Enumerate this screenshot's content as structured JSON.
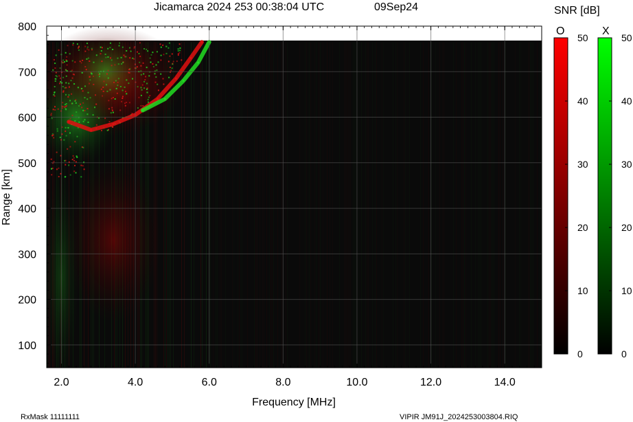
{
  "header": {
    "title": "Jicamarca 2024 253 00:38:04 UTC",
    "date": "09Sep24"
  },
  "footer": {
    "rxmask": "RxMask 11111111",
    "file": "VIPIR  JM91J_2024253003804.RIQ"
  },
  "chart_data": {
    "type": "heatmap",
    "title": "Jicamarca 2024 253 00:38:04 UTC",
    "xlabel": "Frequency [MHz]",
    "ylabel": "Range [km]",
    "xlim": [
      1.6,
      15.0
    ],
    "ylim": [
      50,
      800
    ],
    "data_range_max": 765,
    "x_ticks": [
      2.0,
      4.0,
      6.0,
      8.0,
      10.0,
      12.0,
      14.0
    ],
    "x_tick_labels": [
      "2.0",
      "4.0",
      "6.0",
      "8.0",
      "10.0",
      "12.0",
      "14.0"
    ],
    "y_ticks": [
      100,
      200,
      300,
      400,
      500,
      600,
      700,
      800
    ],
    "y_tick_labels": [
      "100",
      "200",
      "300",
      "400",
      "500",
      "600",
      "700",
      "800"
    ],
    "grid": true,
    "background_color": "#0a0a0a",
    "colorbar": {
      "title": "SNR [dB]",
      "range": [
        0,
        50
      ],
      "ticks": [
        0,
        10,
        20,
        30,
        40,
        50
      ],
      "tick_labels": [
        "0",
        "10",
        "20",
        "30",
        "40",
        "50"
      ],
      "series": [
        {
          "name": "O",
          "color": "#ff0000"
        },
        {
          "name": "X",
          "color": "#00ff00"
        }
      ]
    },
    "traces": [
      {
        "name": "O",
        "color": "#e01010",
        "points": [
          [
            2.2,
            590
          ],
          [
            2.8,
            572
          ],
          [
            3.4,
            585
          ],
          [
            4.0,
            605
          ],
          [
            4.6,
            640
          ],
          [
            5.1,
            685
          ],
          [
            5.5,
            730
          ],
          [
            5.8,
            765
          ]
        ]
      },
      {
        "name": "X",
        "color": "#22dd22",
        "points": [
          [
            4.2,
            615
          ],
          [
            4.8,
            640
          ],
          [
            5.3,
            680
          ],
          [
            5.7,
            720
          ],
          [
            6.0,
            765
          ]
        ]
      }
    ]
  }
}
